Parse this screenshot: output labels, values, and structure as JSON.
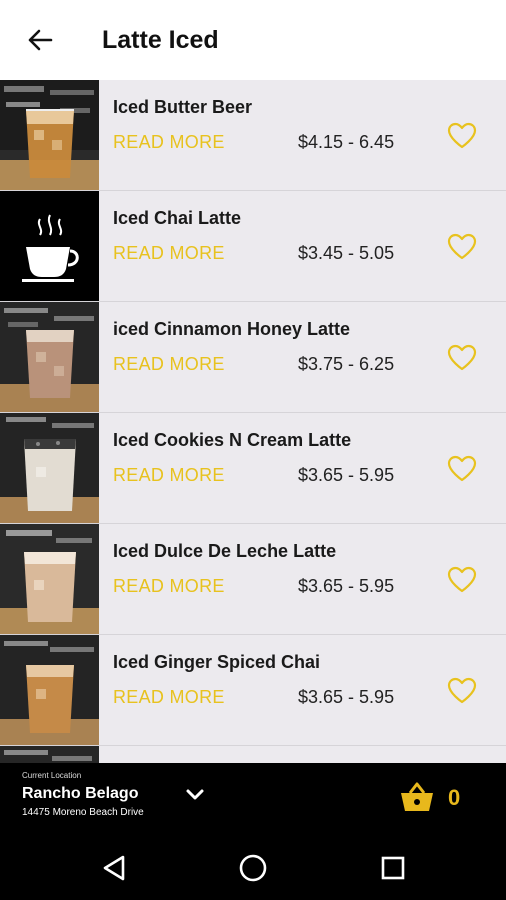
{
  "header": {
    "title": "Latte Iced"
  },
  "items": [
    {
      "name": "Iced Butter Beer",
      "read_more": "READ MORE",
      "price": "$4.15 - 6.45"
    },
    {
      "name": "Iced Chai Latte",
      "read_more": "READ MORE",
      "price": "$3.45 - 5.05"
    },
    {
      "name": "iced Cinnamon Honey Latte",
      "read_more": "READ MORE",
      "price": "$3.75 - 6.25"
    },
    {
      "name": "Iced Cookies N Cream Latte",
      "read_more": "READ MORE",
      "price": "$3.65 - 5.95"
    },
    {
      "name": "Iced Dulce De Leche Latte",
      "read_more": "READ MORE",
      "price": "$3.65 - 5.95"
    },
    {
      "name": "Iced Ginger Spiced Chai",
      "read_more": "READ MORE",
      "price": "$3.65 - 5.95"
    }
  ],
  "location": {
    "caption": "Current Location",
    "name": "Rancho Belago",
    "address": "14475 Moreno Beach Drive"
  },
  "cart": {
    "count": "0"
  },
  "colors": {
    "accent": "#e8c21e",
    "list_background": "#eceaee",
    "bottom_bar": "#000000"
  },
  "icons": {
    "back": "arrow-left-icon",
    "favorite": "heart-outline-icon",
    "dropdown": "chevron-down-icon",
    "cart": "basket-icon",
    "nav_back": "triangle-back-icon",
    "nav_home": "circle-home-icon",
    "nav_recents": "square-recents-icon"
  }
}
